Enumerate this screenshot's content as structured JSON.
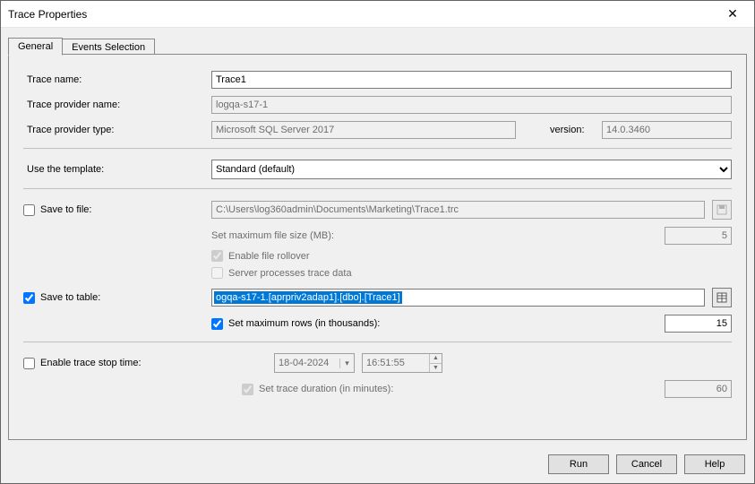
{
  "window": {
    "title": "Trace Properties"
  },
  "tabs": {
    "general": "General",
    "events": "Events Selection"
  },
  "labels": {
    "trace_name": "Trace name:",
    "provider_name": "Trace provider name:",
    "provider_type": "Trace provider type:",
    "version": "version:",
    "use_template": "Use the template:",
    "save_to_file": "Save to file:",
    "max_file_size": "Set maximum file size (MB):",
    "enable_rollover": "Enable file rollover",
    "server_processes": "Server processes trace data",
    "save_to_table": "Save to table:",
    "max_rows": "Set maximum rows (in thousands):",
    "enable_stop_time": "Enable trace stop time:",
    "set_duration": "Set trace duration (in minutes):"
  },
  "values": {
    "trace_name": "Trace1",
    "provider_name": "logqa-s17-1",
    "provider_type": "Microsoft SQL Server 2017",
    "version": "14.0.3460",
    "template": "Standard (default)",
    "file_path": "C:\\Users\\log360admin\\Documents\\Marketing\\Trace1.trc",
    "max_file_size": "5",
    "table_path": "ogqa-s17-1.[aprpriv2adap1].[dbo].[Trace1]",
    "max_rows": "15",
    "stop_date": "18-04-2024",
    "stop_time": "16:51:55",
    "duration": "60"
  },
  "checks": {
    "save_to_file": false,
    "enable_rollover": true,
    "server_processes": false,
    "save_to_table": true,
    "max_rows": true,
    "enable_stop_time": false,
    "set_duration": true
  },
  "buttons": {
    "run": "Run",
    "cancel": "Cancel",
    "help": "Help"
  }
}
